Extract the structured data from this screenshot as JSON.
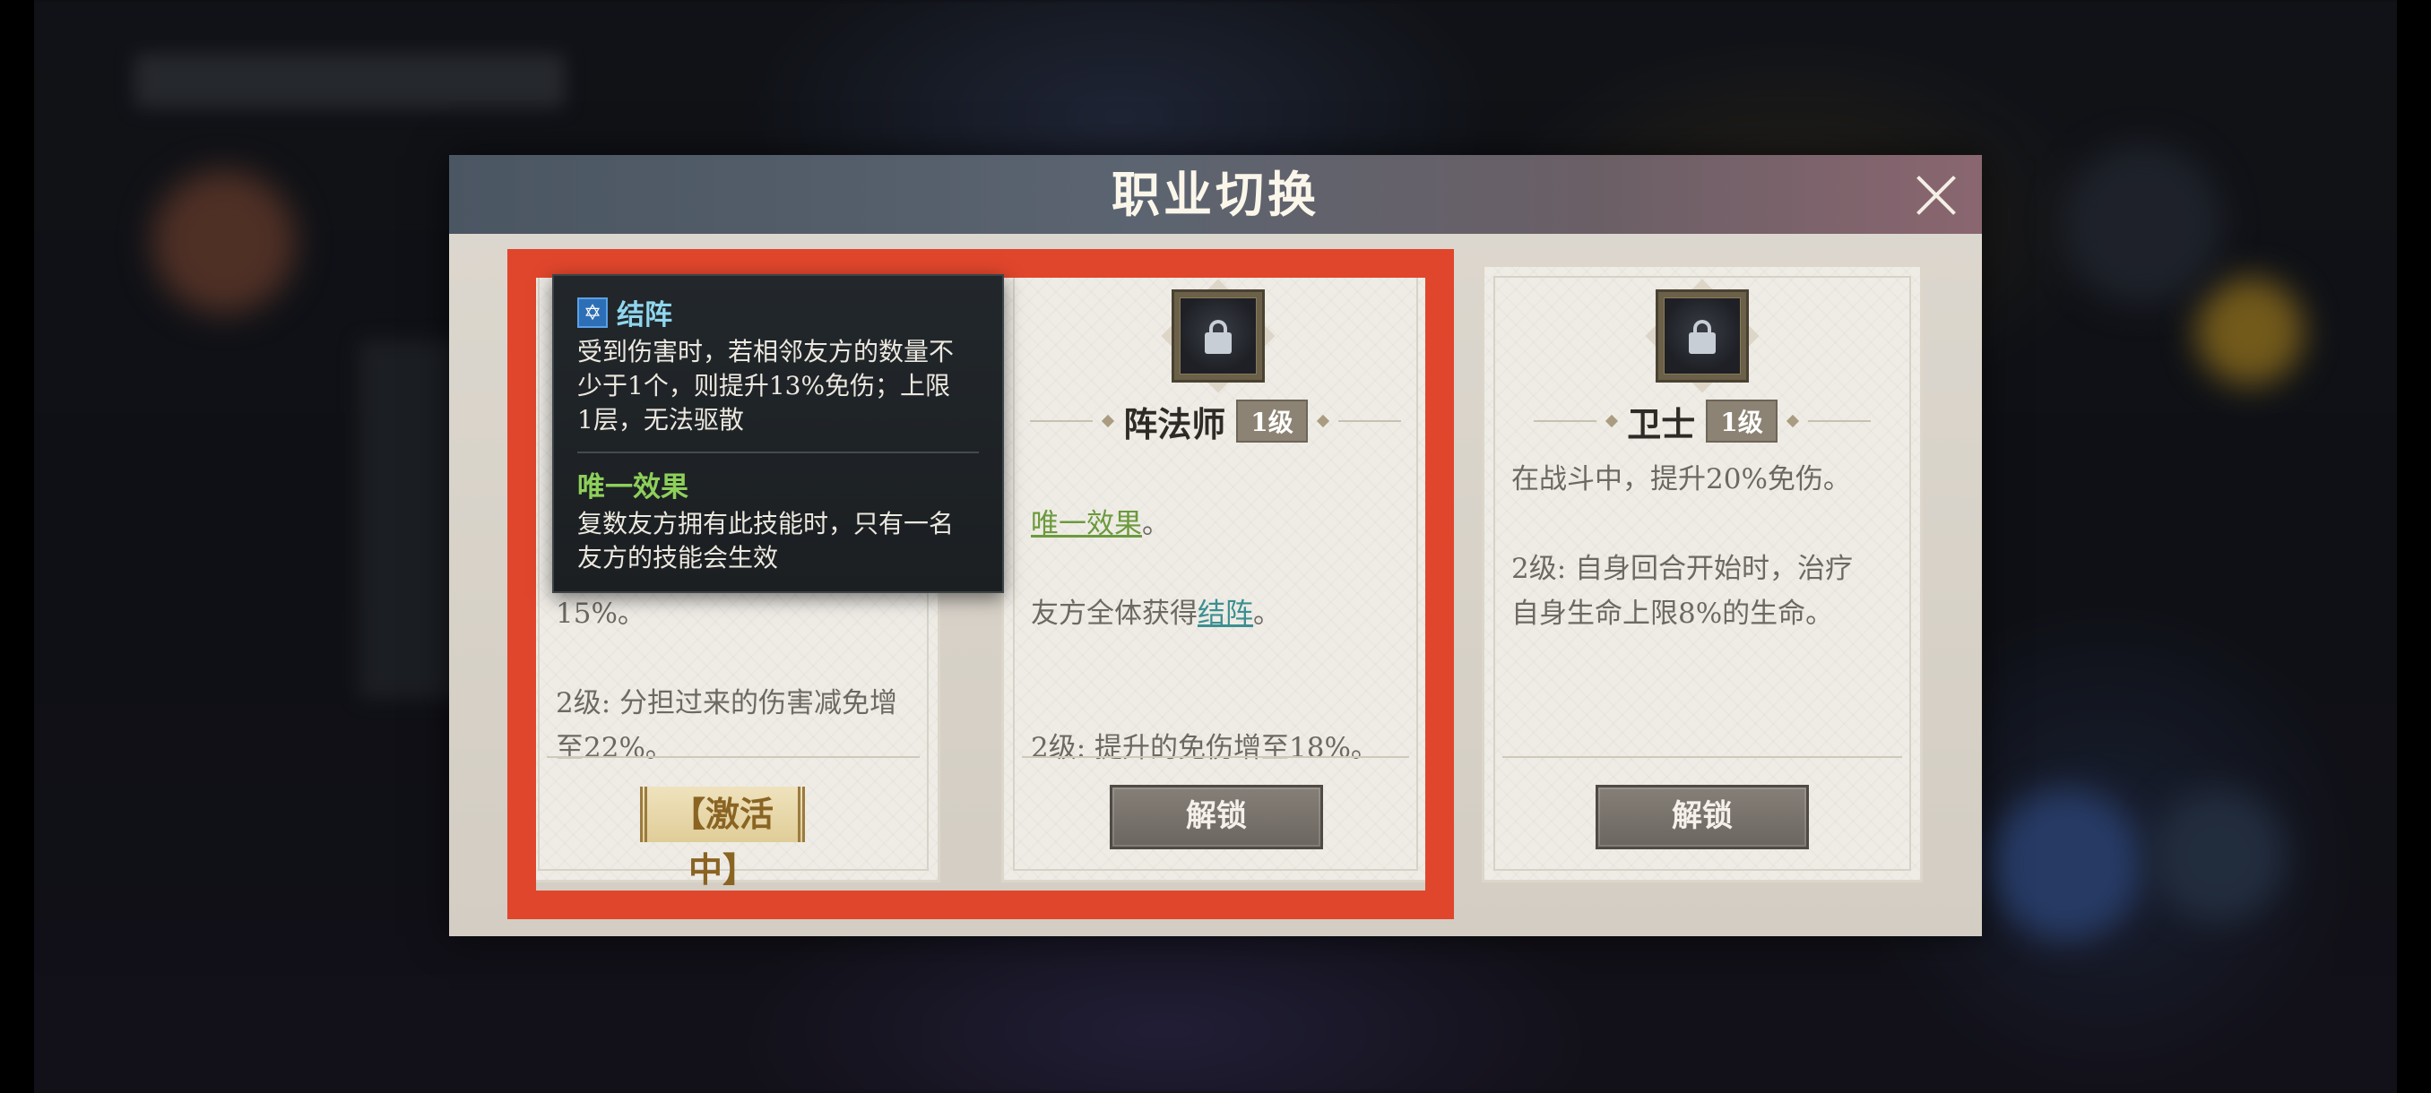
{
  "dialog": {
    "title": "职业切换"
  },
  "cards": [
    {
      "description": "身\n光\n害\n15%。\n\n2级: 分担过来的伤害减免增\n至22%。",
      "status_label": "【激活中】"
    },
    {
      "name": "阵法师",
      "level": "1级",
      "effect_title": "唯一效果",
      "effect_suffix": "。",
      "line2_prefix": "友方全体获得",
      "line2_link": "结阵",
      "line2_suffix": "。",
      "level2_text": "2级: 提升的免伤增至18%。",
      "button_label": "解锁"
    },
    {
      "name": "卫士",
      "level": "1级",
      "description": "在战斗中，提升20%免伤。\n\n2级: 自身回合开始时，治疗\n自身生命上限8%的生命。",
      "button_label": "解锁"
    }
  ],
  "tooltip": {
    "icon": "✡",
    "title": "结阵",
    "body": "受到伤害时，若相邻友方的数量不\n少于1个，则提升13%免伤；上限\n1层，无法驱散",
    "subtitle": "唯一效果",
    "body2": "复数友方拥有此技能时，只有一名\n友方的技能会生效"
  },
  "colors": {
    "highlight": "#e0462c",
    "effect_green": "#6b9a3c",
    "link_teal": "#3b8f91",
    "tooltip_title": "#8fd6ee",
    "tooltip_subtitle": "#8dd05a"
  },
  "icons": {
    "close": "close-icon",
    "lock": "lock-icon",
    "skill": "formation-skill-icon"
  }
}
